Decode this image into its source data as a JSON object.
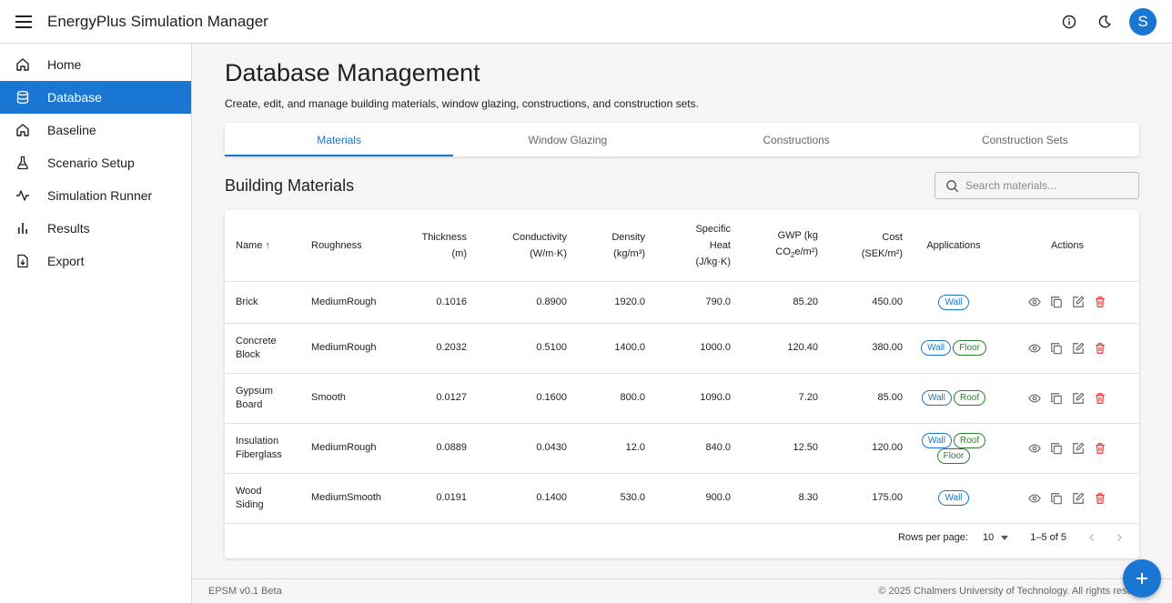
{
  "app": {
    "title": "EnergyPlus Simulation Manager",
    "avatar_initial": "S"
  },
  "sidebar": {
    "items": [
      {
        "label": "Home",
        "icon": "home-icon"
      },
      {
        "label": "Database",
        "icon": "database-icon",
        "active": true
      },
      {
        "label": "Baseline",
        "icon": "home-icon"
      },
      {
        "label": "Scenario Setup",
        "icon": "flask-icon"
      },
      {
        "label": "Simulation Runner",
        "icon": "activity-icon"
      },
      {
        "label": "Results",
        "icon": "bar-chart-icon"
      },
      {
        "label": "Export",
        "icon": "file-export-icon"
      }
    ]
  },
  "main": {
    "title": "Database Management",
    "subtitle": "Create, edit, and manage building materials, window glazing, constructions, and construction sets.",
    "tabs": [
      {
        "label": "Materials",
        "active": true
      },
      {
        "label": "Window Glazing"
      },
      {
        "label": "Constructions"
      },
      {
        "label": "Construction Sets"
      }
    ],
    "section_title": "Building Materials",
    "search_placeholder": "Search materials..."
  },
  "table": {
    "columns": {
      "name": "Name",
      "roughness": "Roughness",
      "thickness_1": "Thickness",
      "thickness_2": "(m)",
      "conductivity_1": "Conductivity",
      "conductivity_2": "(W/m·K)",
      "density_1": "Density",
      "density_2": "(kg/m³)",
      "specific_heat_1": "Specific",
      "specific_heat_2": "Heat",
      "specific_heat_3": "(J/kg·K)",
      "gwp_1": "GWP (kg",
      "gwp_2": "CO",
      "gwp_sub": "2",
      "gwp_3": "e/m²)",
      "cost_1": "Cost",
      "cost_2": "(SEK/m²)",
      "applications": "Applications",
      "actions": "Actions"
    },
    "rows": [
      {
        "name_1": "Brick",
        "name_2": "",
        "roughness": "MediumRough",
        "thickness": "0.1016",
        "conductivity": "0.8900",
        "density": "1920.0",
        "specific_heat": "790.0",
        "gwp": "85.20",
        "cost": "450.00",
        "applications": [
          "Wall"
        ]
      },
      {
        "name_1": "Concrete",
        "name_2": "Block",
        "roughness": "MediumRough",
        "thickness": "0.2032",
        "conductivity": "0.5100",
        "density": "1400.0",
        "specific_heat": "1000.0",
        "gwp": "120.40",
        "cost": "380.00",
        "applications": [
          "Wall",
          "Floor"
        ]
      },
      {
        "name_1": "Gypsum",
        "name_2": "Board",
        "roughness": "Smooth",
        "thickness": "0.0127",
        "conductivity": "0.1600",
        "density": "800.0",
        "specific_heat": "1090.0",
        "gwp": "7.20",
        "cost": "85.00",
        "applications": [
          "Wall",
          "Roof"
        ]
      },
      {
        "name_1": "Insulation",
        "name_2": "Fiberglass",
        "roughness": "MediumRough",
        "thickness": "0.0889",
        "conductivity": "0.0430",
        "density": "12.0",
        "specific_heat": "840.0",
        "gwp": "12.50",
        "cost": "120.00",
        "applications": [
          "Wall",
          "Roof",
          "Floor"
        ]
      },
      {
        "name_1": "Wood",
        "name_2": "Siding",
        "roughness": "MediumSmooth",
        "thickness": "0.0191",
        "conductivity": "0.1400",
        "density": "530.0",
        "specific_heat": "900.0",
        "gwp": "8.30",
        "cost": "175.00",
        "applications": [
          "Wall"
        ]
      }
    ],
    "pagination": {
      "rows_per_page_label": "Rows per page:",
      "rows_per_page": "10",
      "range": "1–5 of 5"
    }
  },
  "footer": {
    "version": "EPSM v0.1 Beta",
    "copyright": "© 2025 Chalmers University of Technology. All rights reserved."
  },
  "colors": {
    "primary": "#1976d2",
    "danger": "#e53935",
    "success": "#2e7d32"
  }
}
